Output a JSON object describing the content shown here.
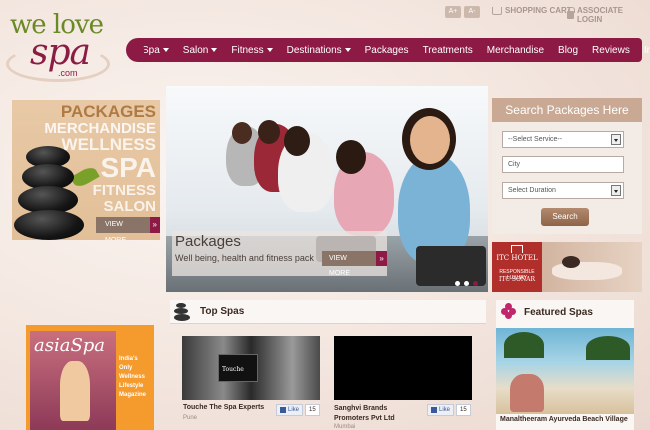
{
  "logo": {
    "top_text": "we love",
    "main_text": "spa",
    "suffix": ".com"
  },
  "utility": {
    "font_increase": "A+",
    "font_decrease": "A-",
    "shopping_cart": "SHOPPING CART",
    "associate_login": "ASSOCIATE LOGIN"
  },
  "nav": {
    "items": [
      {
        "label": "Spa",
        "dropdown": true
      },
      {
        "label": "Salon",
        "dropdown": true
      },
      {
        "label": "Fitness",
        "dropdown": true
      },
      {
        "label": "Destinations",
        "dropdown": true
      },
      {
        "label": "Packages",
        "dropdown": false
      },
      {
        "label": "Treatments",
        "dropdown": false
      },
      {
        "label": "Merchandise",
        "dropdown": false
      },
      {
        "label": "Blog",
        "dropdown": false
      },
      {
        "label": "Reviews",
        "dropdown": false
      },
      {
        "label": "Info",
        "dropdown": false
      }
    ]
  },
  "promo": {
    "words": [
      "PACKAGES",
      "MERCHANDISE",
      "WELLNESS",
      "SPA",
      "FITNESS",
      "SALON"
    ],
    "view_more": "VIEW MORE",
    "arrow": "»"
  },
  "hero": {
    "title": "Packages",
    "subtitle": "Well being, health and fitness pack",
    "view_more": "VIEW MORE",
    "arrow": "»"
  },
  "search": {
    "title": "Search Packages Here",
    "service_value": "--Select Service--",
    "city_placeholder": "City",
    "duration_value": "Select Duration",
    "button": "Search"
  },
  "ad": {
    "brand": "ITC HOTEL",
    "tagline": "RESPONSIBLE LUXURY",
    "property": "ITC SONAR"
  },
  "magazine": {
    "title": "asiaSpa",
    "blurb": "India's Only Wellness Lifestyle Magazine"
  },
  "top_spas": {
    "heading": "Top Spas",
    "items": [
      {
        "name": "Touche The Spa Experts",
        "city": "Pune",
        "like_label": "Like",
        "like_count": "15",
        "image_text": "Touche"
      },
      {
        "name": "Sanghvi Brands Promoters Pvt Ltd",
        "city": "Mumbai",
        "like_label": "Like",
        "like_count": "15"
      }
    ]
  },
  "featured_spas": {
    "heading": "Featured Spas",
    "name": "Manaltheeram Ayurveda Beach Village"
  },
  "colors": {
    "nav_bg": "#8d1a45",
    "accent_brown": "#8a7468",
    "search_head": "#c9a993",
    "magazine_orange": "#f59a2c"
  }
}
